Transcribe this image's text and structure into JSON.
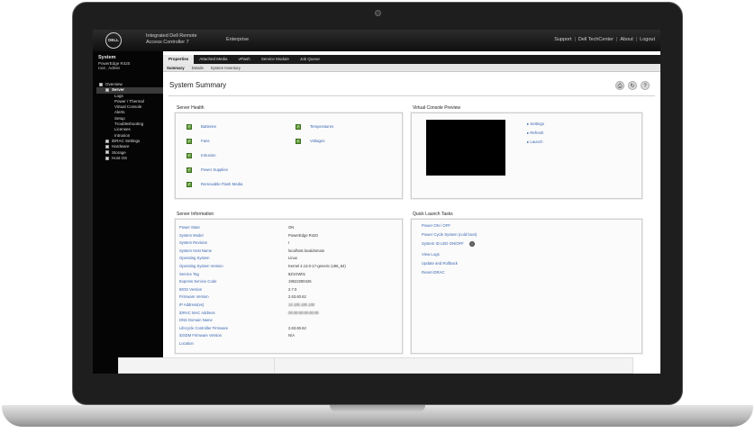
{
  "header": {
    "logo": "DELL",
    "product_line1": "Integrated Dell Remote",
    "product_line2": "Access Controller 7",
    "edition": "Enterprise",
    "links": [
      "Support",
      "Dell TechCenter",
      "About",
      "Logout"
    ]
  },
  "sidebar": {
    "title": "System",
    "model": "PowerEdge R420",
    "user": "root , Admin",
    "tree": [
      {
        "label": "Overview",
        "level": 1,
        "box": true
      },
      {
        "label": "Server",
        "level": 2,
        "box": true,
        "selected": true
      },
      {
        "label": "Logs",
        "level": 3
      },
      {
        "label": "Power / Thermal",
        "level": 3
      },
      {
        "label": "Virtual Console",
        "level": 3
      },
      {
        "label": "Alerts",
        "level": 3
      },
      {
        "label": "Setup",
        "level": 3
      },
      {
        "label": "Troubleshooting",
        "level": 3
      },
      {
        "label": "Licenses",
        "level": 3
      },
      {
        "label": "Intrusion",
        "level": 3
      },
      {
        "label": "iDRAC Settings",
        "level": 2,
        "box": true
      },
      {
        "label": "Hardware",
        "level": 2,
        "box": true
      },
      {
        "label": "Storage",
        "level": 2,
        "box": true
      },
      {
        "label": "Host OS",
        "level": 2,
        "box": true
      }
    ]
  },
  "tabs": [
    "Properties",
    "Attached Media",
    "vFlash",
    "Service Module",
    "Job Queue"
  ],
  "subtabs": [
    "Summary",
    "Details",
    "System Inventory"
  ],
  "page": {
    "title": "System Summary",
    "tools": [
      "print-icon",
      "refresh-icon",
      "help-icon"
    ]
  },
  "server_health": {
    "title": "Server Health",
    "left": [
      "Batteries",
      "Fans",
      "Intrusion",
      "Power Supplies",
      "Removable Flash Media"
    ],
    "right": [
      "Temperatures",
      "Voltages"
    ]
  },
  "virtual_console": {
    "title": "Virtual Console Preview",
    "links": [
      "Settings",
      "Refresh",
      "Launch"
    ]
  },
  "server_info": {
    "title": "Server Information",
    "rows": [
      {
        "label": "Power State",
        "value": "ON"
      },
      {
        "label": "System Model",
        "value": "PowerEdge R420"
      },
      {
        "label": "System Revision",
        "value": "I"
      },
      {
        "label": "System Host Name",
        "value": "localhost.localdomain"
      },
      {
        "label": "Operating System",
        "value": "Linux"
      },
      {
        "label": "Operating System Version",
        "value": "Kernel 4.13.0-17-generic (x86_64)"
      },
      {
        "label": "Service Tag",
        "value": "8Z1GW01"
      },
      {
        "label": "Express Service Code",
        "value": "19522280425"
      },
      {
        "label": "BIOS Version",
        "value": "2.7.0"
      },
      {
        "label": "Firmware Version",
        "value": "2.63.60.62"
      },
      {
        "label": "IP Address(es)",
        "value": "10.100.100.100"
      },
      {
        "label": "iDRAC MAC Address",
        "value": "00:00:00:00:00:00"
      },
      {
        "label": "DNS Domain Name",
        "value": ""
      },
      {
        "label": "Lifecycle Controller Firmware",
        "value": "2.63.60.62"
      },
      {
        "label": "iDSDM Firmware Version",
        "value": "N/A"
      },
      {
        "label": "Location",
        "value": ""
      }
    ]
  },
  "quick_launch": {
    "title": "Quick Launch Tasks",
    "items": [
      "Power ON / OFF",
      "Power Cycle System (cold boot)",
      "System ID LED ON/OFF",
      "View Logs",
      "Update and Rollback",
      "Reset iDRAC"
    ]
  }
}
